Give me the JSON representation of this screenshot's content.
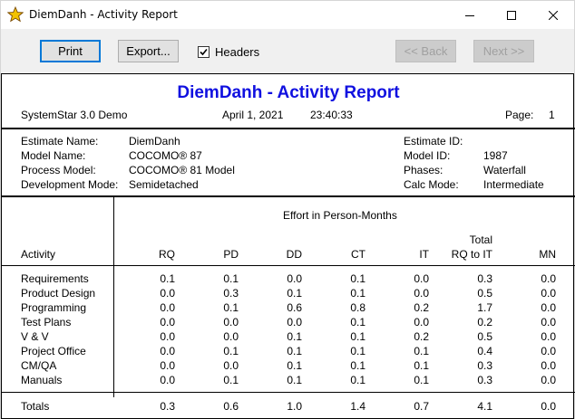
{
  "window": {
    "title": "DiemDanh - Activity Report"
  },
  "toolbar": {
    "print_label": "Print",
    "export_label": "Export...",
    "headers_label": "Headers",
    "headers_checked": true,
    "back_label": "<< Back",
    "next_label": "Next >>"
  },
  "report": {
    "title": "DiemDanh - Activity Report",
    "product": "SystemStar 3.0 Demo",
    "date": "April 1, 2021",
    "time": "23:40:33",
    "page_label": "Page:",
    "page_number": "1",
    "info_left": [
      {
        "label": "Estimate Name:",
        "value": "DiemDanh"
      },
      {
        "label": "Model Name:",
        "value": "COCOMO® 87"
      },
      {
        "label": "Process Model:",
        "value": "COCOMO® 81 Model"
      },
      {
        "label": "Development Mode:",
        "value": "Semidetached"
      }
    ],
    "info_right": [
      {
        "label": "Estimate ID:",
        "value": ""
      },
      {
        "label": "Model ID:",
        "value": "1987"
      },
      {
        "label": "Phases:",
        "value": "Waterfall"
      },
      {
        "label": "Calc Mode:",
        "value": "Intermediate"
      }
    ],
    "effort_header": "Effort in Person-Months",
    "activity_header": "Activity",
    "columns": [
      "RQ",
      "PD",
      "DD",
      "CT",
      "IT",
      "Total",
      "MN"
    ],
    "total_column_line1": "Total",
    "total_column_line2": "RQ to IT",
    "rows": [
      {
        "activity": "Requirements",
        "values": [
          "0.1",
          "0.1",
          "0.0",
          "0.1",
          "0.0",
          "0.3",
          "0.0"
        ]
      },
      {
        "activity": "Product Design",
        "values": [
          "0.0",
          "0.3",
          "0.1",
          "0.1",
          "0.0",
          "0.5",
          "0.0"
        ]
      },
      {
        "activity": "Programming",
        "values": [
          "0.0",
          "0.1",
          "0.6",
          "0.8",
          "0.2",
          "1.7",
          "0.0"
        ]
      },
      {
        "activity": "Test Plans",
        "values": [
          "0.0",
          "0.0",
          "0.0",
          "0.1",
          "0.0",
          "0.2",
          "0.0"
        ]
      },
      {
        "activity": "V & V",
        "values": [
          "0.0",
          "0.0",
          "0.1",
          "0.1",
          "0.2",
          "0.5",
          "0.0"
        ]
      },
      {
        "activity": "Project Office",
        "values": [
          "0.0",
          "0.1",
          "0.1",
          "0.1",
          "0.1",
          "0.4",
          "0.0"
        ]
      },
      {
        "activity": "CM/QA",
        "values": [
          "0.0",
          "0.0",
          "0.1",
          "0.1",
          "0.1",
          "0.3",
          "0.0"
        ]
      },
      {
        "activity": "Manuals",
        "values": [
          "0.0",
          "0.1",
          "0.1",
          "0.1",
          "0.1",
          "0.3",
          "0.0"
        ]
      }
    ],
    "totals": {
      "activity": "Totals",
      "values": [
        "0.3",
        "0.6",
        "1.0",
        "1.4",
        "0.7",
        "4.1",
        "0.0"
      ]
    }
  }
}
